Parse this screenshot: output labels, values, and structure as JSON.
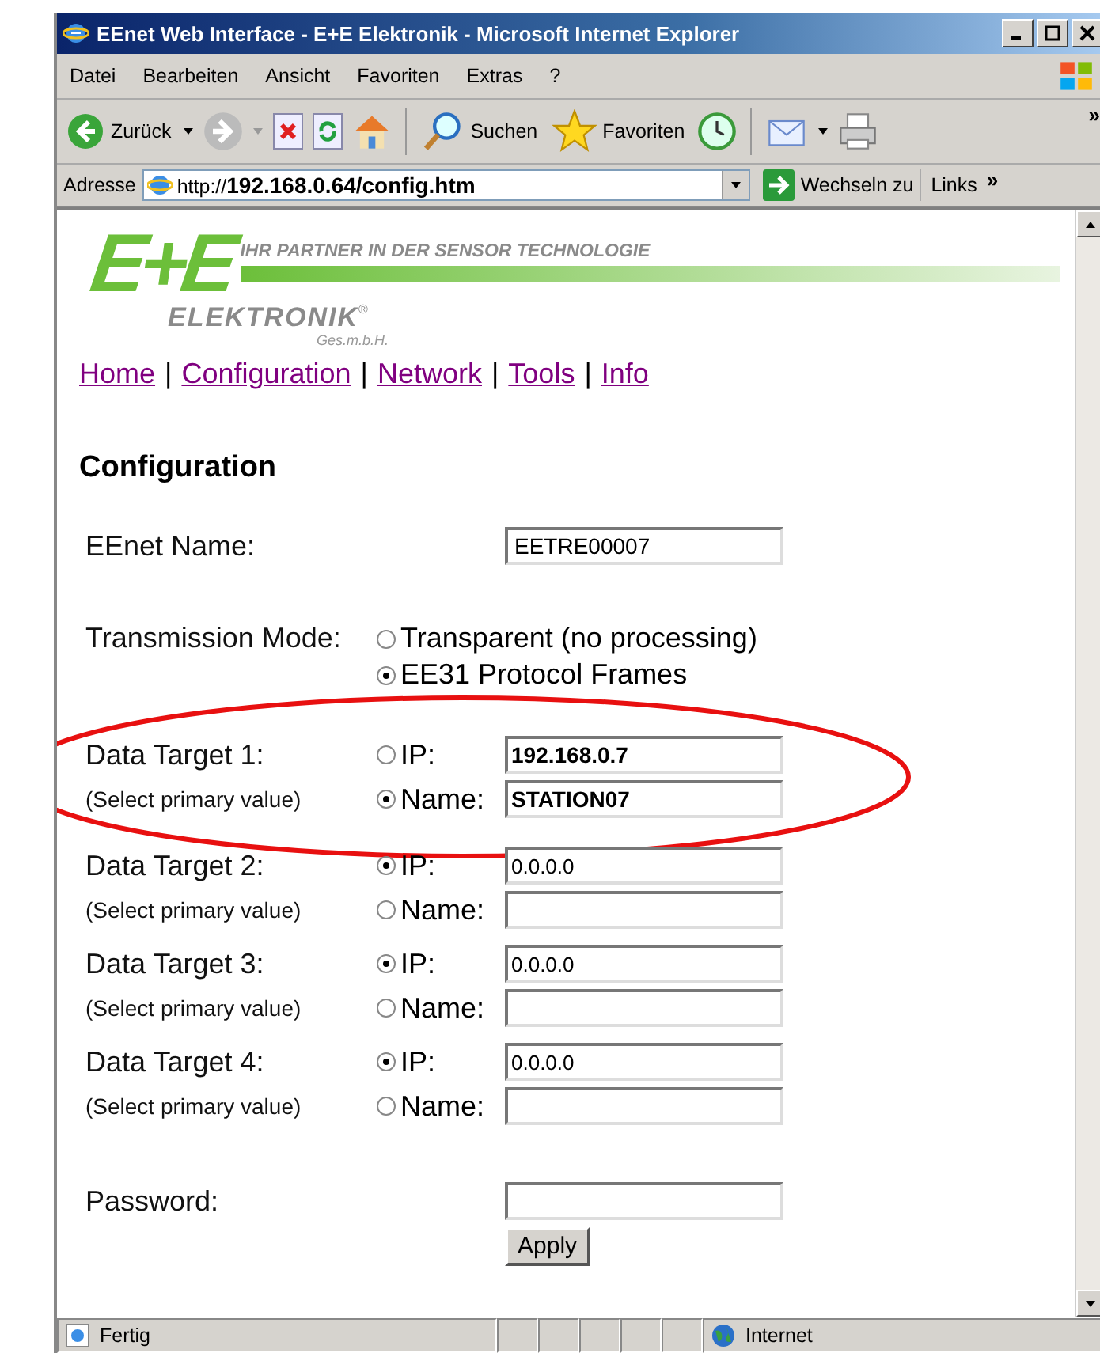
{
  "window": {
    "title": "EEnet Web Interface - E+E Elektronik - Microsoft Internet Explorer"
  },
  "menu": [
    "Datei",
    "Bearbeiten",
    "Ansicht",
    "Favoriten",
    "Extras",
    "?"
  ],
  "toolbar": {
    "back": "Zurück",
    "search": "Suchen",
    "favorites": "Favoriten",
    "more": "»"
  },
  "address_bar": {
    "label": "Adresse",
    "url": "http://**192.168.0.64/config.htm**",
    "go": "Wechseln zu",
    "links": "Links",
    "more": "»"
  },
  "logo": {
    "mark": "E+E",
    "slogan": "IHR PARTNER IN DER SENSOR TECHNOLOGIE",
    "name": "ELEKTRONIK",
    "registered": "®",
    "legal": "Ges.m.b.H."
  },
  "nav": {
    "links": [
      "Home",
      "Configuration",
      "Network",
      "Tools",
      "Info"
    ],
    "separator": "|"
  },
  "heading": "Configuration",
  "eenet_name": {
    "label": "EEnet Name:",
    "value": "EETRE00007"
  },
  "transmission_mode": {
    "label": "Transmission Mode:",
    "options": [
      {
        "label": "Transparent (no processing)",
        "selected": false
      },
      {
        "label": "EE31 Protocol Frames",
        "selected": true
      }
    ]
  },
  "data_targets": [
    {
      "label": "Data Target 1:",
      "hint": "(Select primary value)",
      "bold": true,
      "options": [
        {
          "label": "IP:",
          "value": "192.168.0.7",
          "selected": false
        },
        {
          "label": "Name:",
          "value": "STATION07",
          "selected": true
        }
      ]
    },
    {
      "label": "Data Target 2:",
      "hint": "(Select primary value)",
      "bold": false,
      "options": [
        {
          "label": "IP:",
          "value": "0.0.0.0",
          "selected": true
        },
        {
          "label": "Name:",
          "selected": false
        }
      ]
    },
    {
      "label": "Data Target 3:",
      "hint": "(Select primary value)",
      "bold": false,
      "options": [
        {
          "label": "IP:",
          "value": "0.0.0.0",
          "selected": true
        },
        {
          "label": "Name:",
          "selected": false
        }
      ]
    },
    {
      "label": "Data Target 4:",
      "hint": "(Select primary value)",
      "bold": false,
      "options": [
        {
          "label": "IP:",
          "value": "0.0.0.0",
          "selected": true
        },
        {
          "label": "Name:",
          "selected": false
        }
      ]
    }
  ],
  "password": {
    "label": "Password:"
  },
  "apply_button": "Apply",
  "status_bar": {
    "status": "Fertig",
    "zone": "Internet"
  }
}
